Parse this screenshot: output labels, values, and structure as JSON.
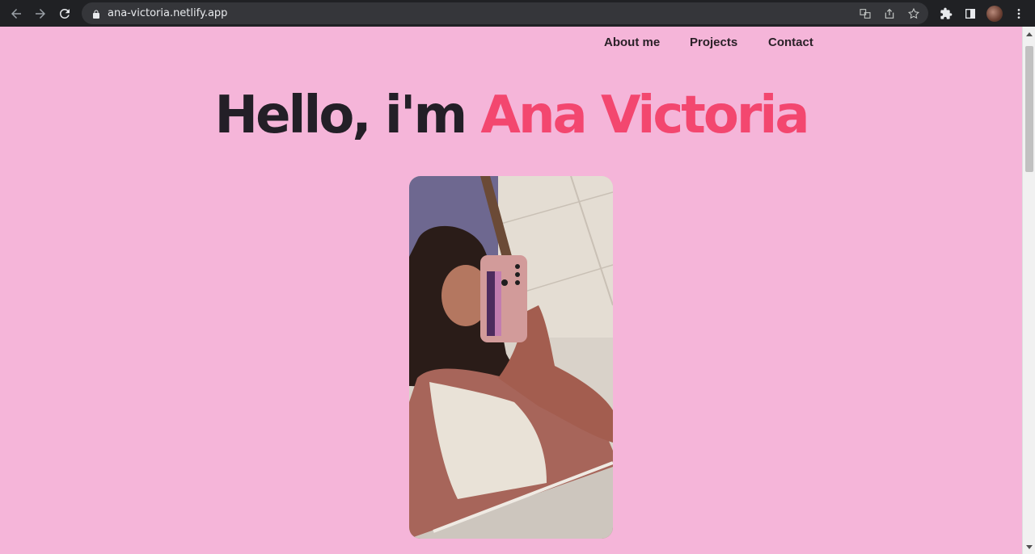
{
  "browser": {
    "url": "ana-victoria.netlify.app"
  },
  "nav": {
    "items": [
      "About me",
      "Projects",
      "Contact"
    ]
  },
  "hero": {
    "greeting": "Hello, i'm",
    "name": "Ana Victoria"
  },
  "colors": {
    "background": "#f5b5d9",
    "heading_dark": "#231f27",
    "accent_pink": "#f3476f"
  },
  "icons": {
    "back": "arrow-left-icon",
    "forward": "arrow-right-icon",
    "reload": "reload-icon",
    "lock": "lock-icon",
    "translate": "translate-icon",
    "share": "share-icon",
    "bookmark": "star-icon",
    "extensions": "puzzle-icon",
    "side_panel": "side-panel-icon",
    "menu": "kebab-menu-icon"
  }
}
